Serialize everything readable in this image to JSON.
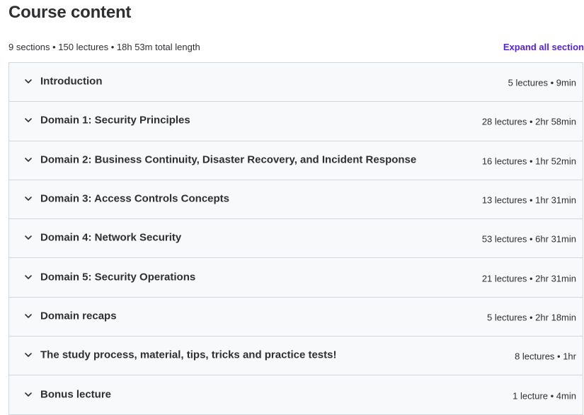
{
  "header": {
    "title": "Course content"
  },
  "summary": {
    "text": "9 sections • 150 lectures • 18h 53m total length",
    "expand_label": "Expand all section"
  },
  "colors": {
    "accent": "#5624d0",
    "row_background": "#f7f9fa",
    "border": "#d1d7dc",
    "text": "#2d2f31"
  },
  "icons": {
    "row_toggle": "chevron-down-icon"
  },
  "sections": [
    {
      "title": "Introduction",
      "meta": "5 lectures • 9min"
    },
    {
      "title": "Domain 1: Security Principles",
      "meta": "28 lectures • 2hr 58min"
    },
    {
      "title": "Domain 2: Business Continuity, Disaster Recovery, and Incident Response",
      "meta": "16 lectures • 1hr 52min"
    },
    {
      "title": "Domain 3: Access Controls Concepts",
      "meta": "13 lectures • 1hr 31min"
    },
    {
      "title": "Domain 4: Network Security",
      "meta": "53 lectures • 6hr 31min"
    },
    {
      "title": "Domain 5: Security Operations",
      "meta": "21 lectures • 2hr 31min"
    },
    {
      "title": "Domain recaps",
      "meta": "5 lectures • 2hr 18min"
    },
    {
      "title": "The study process, material, tips, tricks and practice tests!",
      "meta": "8 lectures • 1hr"
    },
    {
      "title": "Bonus lecture",
      "meta": "1 lecture • 4min"
    }
  ]
}
